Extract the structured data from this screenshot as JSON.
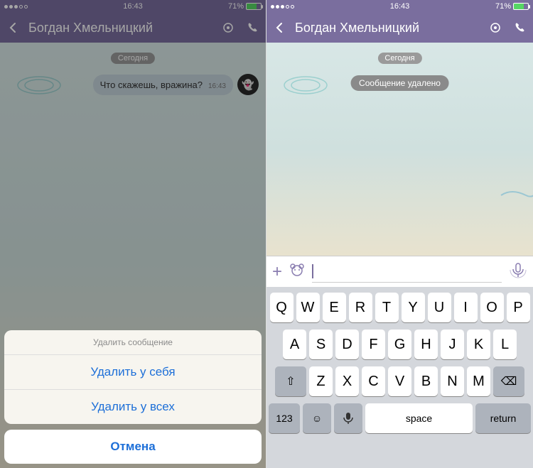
{
  "status": {
    "time": "16:43",
    "battery": "71%"
  },
  "header": {
    "title": "Богдан Хмельницкий"
  },
  "chat": {
    "day": "Сегодня",
    "message_text": "Что скажешь, вражина?",
    "message_time": "16:43",
    "deleted": "Сообщение удалено"
  },
  "sheet": {
    "title": "Удалить сообщение",
    "opt1": "Удалить у себя",
    "opt2": "Удалить у всех",
    "cancel": "Отмена"
  },
  "keyboard": {
    "r1": [
      "Q",
      "W",
      "E",
      "R",
      "T",
      "Y",
      "U",
      "I",
      "O",
      "P"
    ],
    "r2": [
      "A",
      "S",
      "D",
      "F",
      "G",
      "H",
      "J",
      "K",
      "L"
    ],
    "r3": [
      "Z",
      "X",
      "C",
      "V",
      "B",
      "N",
      "M"
    ],
    "shift": "⇧",
    "bksp": "⌫",
    "k123": "123",
    "emoji": "☺",
    "mic": "🎤",
    "space": "space",
    "ret": "return"
  }
}
